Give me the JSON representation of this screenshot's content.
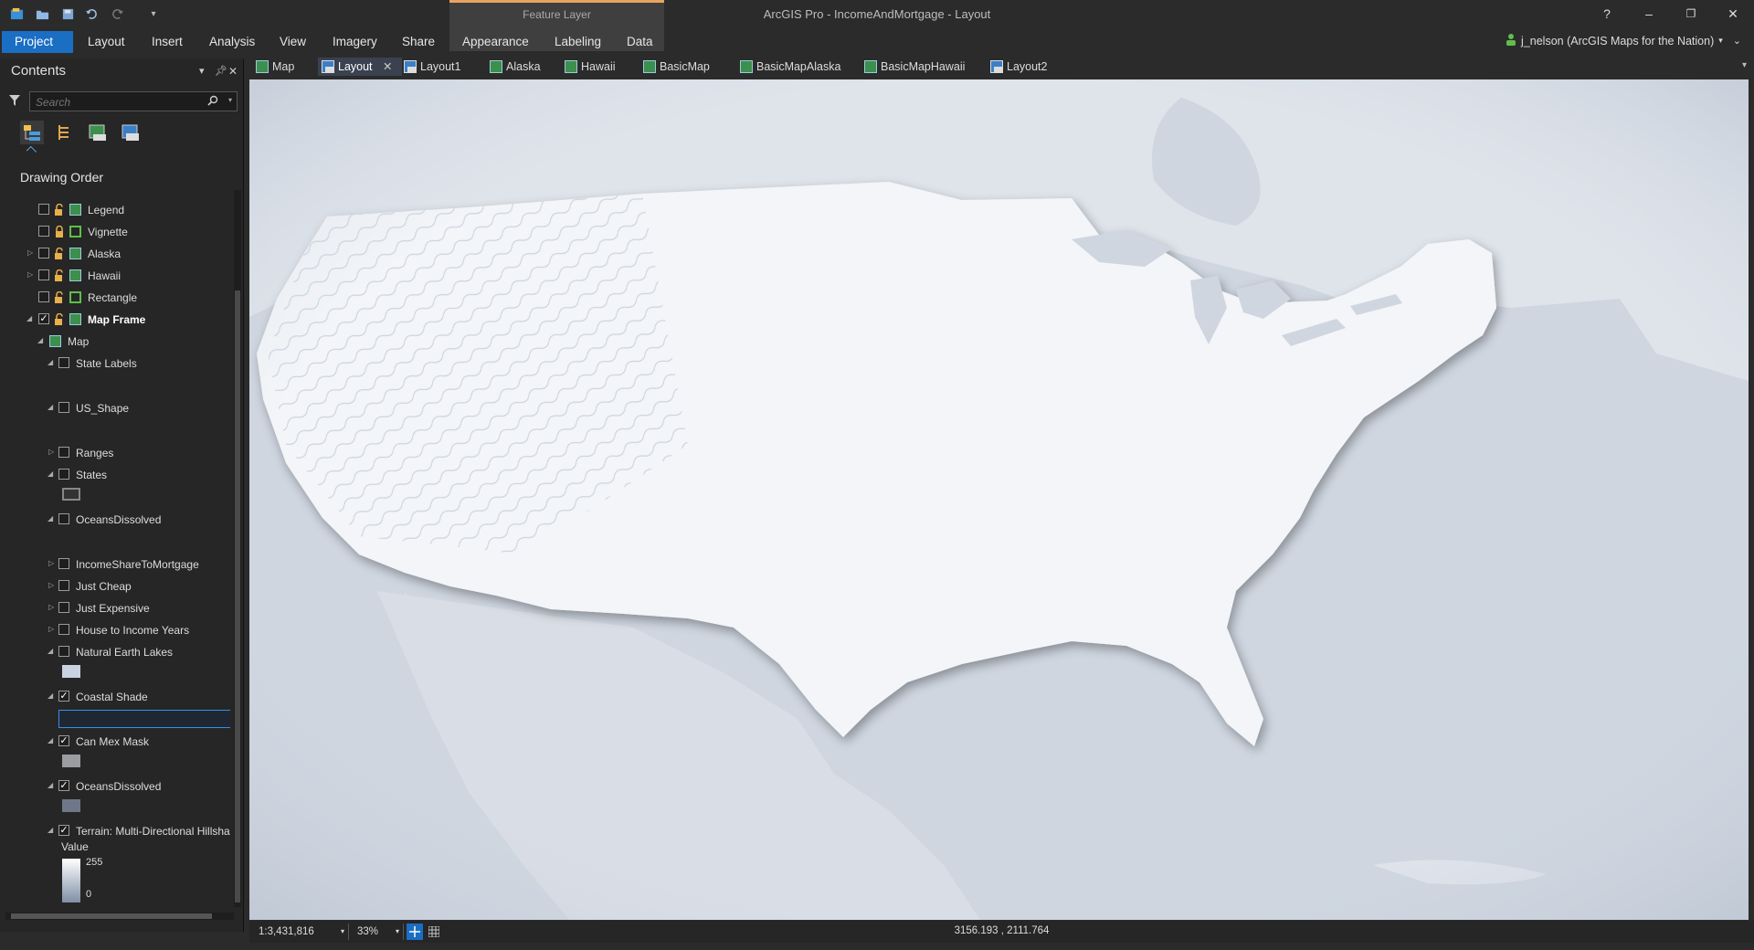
{
  "app": {
    "title": "ArcGIS Pro - IncomeAndMortgage - Layout",
    "context_group": "Feature Layer",
    "help": "?",
    "minimize": "–",
    "restore": "❐",
    "close": "✕"
  },
  "ribbon": {
    "tabs": [
      {
        "label": "Project"
      },
      {
        "label": "Layout"
      },
      {
        "label": "Insert"
      },
      {
        "label": "Analysis"
      },
      {
        "label": "View"
      },
      {
        "label": "Imagery"
      },
      {
        "label": "Share"
      },
      {
        "label": "Appearance"
      },
      {
        "label": "Labeling"
      },
      {
        "label": "Data"
      }
    ],
    "user": "j_nelson (ArcGIS Maps for the Nation)"
  },
  "contents": {
    "title": "Contents",
    "search_placeholder": "Search",
    "section": "Drawing Order",
    "legend_value_label": "Value",
    "legend_high": "255",
    "legend_low": "0"
  },
  "toc": [
    {
      "label": "Legend"
    },
    {
      "label": "Vignette"
    },
    {
      "label": "Alaska"
    },
    {
      "label": "Hawaii"
    },
    {
      "label": "Rectangle"
    },
    {
      "label": "Map Frame"
    },
    {
      "label": "Map"
    },
    {
      "label": "State Labels"
    },
    {
      "label": "US_Shape"
    },
    {
      "label": "Ranges"
    },
    {
      "label": "States"
    },
    {
      "label": "OceansDissolved"
    },
    {
      "label": "IncomeShareToMortgage"
    },
    {
      "label": "Just Cheap"
    },
    {
      "label": "Just Expensive"
    },
    {
      "label": "House to Income Years"
    },
    {
      "label": "Natural Earth Lakes"
    },
    {
      "label": "Coastal Shade"
    },
    {
      "label": "Can Mex Mask"
    },
    {
      "label": "OceansDissolved"
    },
    {
      "label": "Terrain: Multi-Directional Hillshade"
    }
  ],
  "view_tabs": [
    {
      "label": "Map"
    },
    {
      "label": "Layout"
    },
    {
      "label": "Layout1"
    },
    {
      "label": "Alaska"
    },
    {
      "label": "Hawaii"
    },
    {
      "label": "BasicMap"
    },
    {
      "label": "BasicMapAlaska"
    },
    {
      "label": "BasicMapHawaii"
    },
    {
      "label": "Layout2"
    }
  ],
  "status": {
    "scale": "1:3,431,816",
    "zoom": "33%",
    "coordinates": "3156.193 , 2111.764"
  },
  "colors": {
    "accent": "#1a6ec3",
    "context": "#e8a45d",
    "ocean": "#cfd6e0",
    "land": "#f3f5f8"
  }
}
